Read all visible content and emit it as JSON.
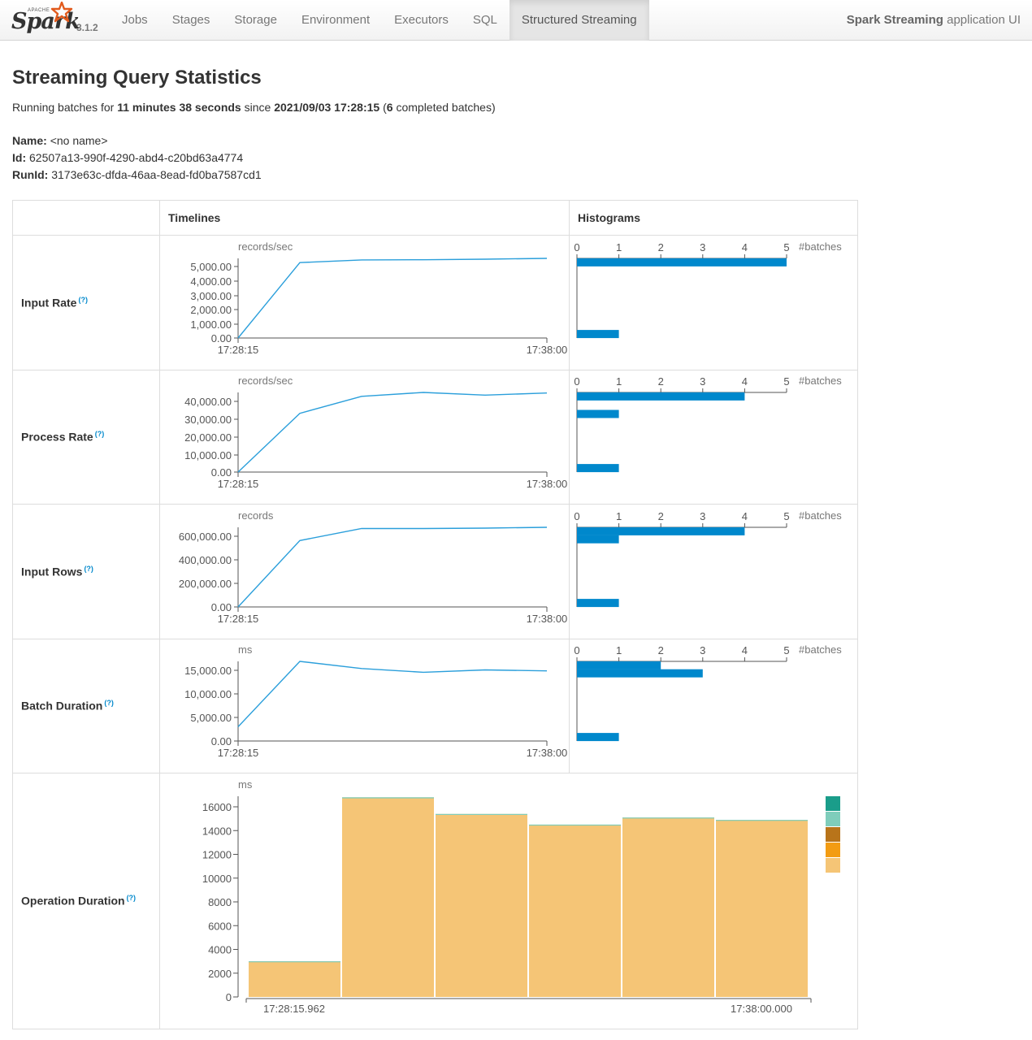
{
  "navbar": {
    "logo_apache": "APACHE",
    "logo_text": "Spark",
    "version": "3.1.2",
    "items": [
      {
        "label": "Jobs",
        "active": false
      },
      {
        "label": "Stages",
        "active": false
      },
      {
        "label": "Storage",
        "active": false
      },
      {
        "label": "Environment",
        "active": false
      },
      {
        "label": "Executors",
        "active": false
      },
      {
        "label": "SQL",
        "active": false
      },
      {
        "label": "Structured Streaming",
        "active": true
      }
    ],
    "app_name": "Spark Streaming",
    "app_suffix": "application UI"
  },
  "page": {
    "title": "Streaming Query Statistics",
    "summary": {
      "prefix": "Running batches for",
      "duration": "11 minutes 38 seconds",
      "since_word": "since",
      "since_time": "2021/09/03 17:28:15",
      "open_paren": "(",
      "completed": "6",
      "completed_suffix": "completed batches)"
    },
    "info": {
      "name_label": "Name:",
      "name_value": "<no name>",
      "id_label": "Id:",
      "id_value": "62507a13-990f-4290-abd4-c20bd63a4774",
      "runid_label": "RunId:",
      "runid_value": "3173e63c-dfda-46aa-8ead-fd0ba7587cd1"
    }
  },
  "table": {
    "headers": {
      "timelines": "Timelines",
      "histograms": "Histograms"
    },
    "help_marker": "(?)",
    "rows": [
      {
        "label": "Input Rate"
      },
      {
        "label": "Process Rate"
      },
      {
        "label": "Input Rows"
      },
      {
        "label": "Batch Duration"
      },
      {
        "label": "Operation Duration"
      }
    ]
  },
  "colors": {
    "line": "#2b9fdb",
    "histogram_bar": "#0088cc",
    "op_duration": [
      "#1a9d8a",
      "#7fcdbb",
      "#b8741a",
      "#f39c12",
      "#f5c576"
    ]
  },
  "chart_data": [
    {
      "type": "line",
      "title": "Input Rate",
      "ylabel": "records/sec",
      "x": [
        "17:28:15",
        "",
        "",
        "",
        "",
        "17:38:00"
      ],
      "values": [
        0,
        5500,
        5700,
        5710,
        5750,
        5810
      ],
      "yticks": [
        "5,000.00",
        "4,000.00",
        "3,000.00",
        "2,000.00",
        "1,000.00",
        "0.00"
      ],
      "ylim": [
        0,
        5810
      ],
      "xticks": [
        "17:28:15",
        "17:38:00"
      ],
      "grid": false
    },
    {
      "type": "bar",
      "title": "Input Rate histogram",
      "xlabel": "#batches",
      "xticks": [
        "0",
        "1",
        "2",
        "3",
        "4",
        "5"
      ],
      "counts": [
        5,
        1
      ],
      "bin_fractions": [
        0.95,
        0.05
      ],
      "xlim": [
        0,
        5
      ]
    },
    {
      "type": "line",
      "title": "Process Rate",
      "ylabel": "records/sec",
      "x": [
        "17:28:15",
        "",
        "",
        "",
        "",
        "17:38:00"
      ],
      "values": [
        0,
        33000,
        42500,
        44700,
        43200,
        44400
      ],
      "yticks": [
        "40,000.00",
        "30,000.00",
        "20,000.00",
        "10,000.00",
        "0.00"
      ],
      "ylim": [
        0,
        44700
      ],
      "xticks": [
        "17:28:15",
        "17:38:00"
      ],
      "grid": false
    },
    {
      "type": "bar",
      "title": "Process Rate histogram",
      "xlabel": "#batches",
      "xticks": [
        "0",
        "1",
        "2",
        "3",
        "4",
        "5"
      ],
      "counts": [
        4,
        1,
        1
      ],
      "bin_fractions": [
        0.95,
        0.73,
        0.05
      ],
      "xlim": [
        0,
        5
      ]
    },
    {
      "type": "line",
      "title": "Input Rows",
      "ylabel": "records",
      "x": [
        "17:28:15",
        "",
        "",
        "",
        "",
        "17:38:00"
      ],
      "values": [
        0,
        560000,
        662000,
        662000,
        665000,
        672000
      ],
      "yticks": [
        "600,000.00",
        "400,000.00",
        "200,000.00",
        "0.00"
      ],
      "ylim": [
        0,
        672000
      ],
      "xticks": [
        "17:28:15",
        "17:38:00"
      ],
      "grid": false
    },
    {
      "type": "bar",
      "title": "Input Rows histogram",
      "xlabel": "#batches",
      "xticks": [
        "0",
        "1",
        "2",
        "3",
        "4",
        "5"
      ],
      "counts": [
        4,
        1,
        1
      ],
      "bin_fractions": [
        0.95,
        0.85,
        0.05
      ],
      "xlim": [
        0,
        5
      ]
    },
    {
      "type": "line",
      "title": "Batch Duration",
      "ylabel": "ms",
      "x": [
        "17:28:15",
        "",
        "",
        "",
        "",
        "17:38:00"
      ],
      "values": [
        3000,
        16800,
        15300,
        14500,
        15000,
        14800
      ],
      "yticks": [
        "15,000.00",
        "10,000.00",
        "5,000.00",
        "0.00"
      ],
      "ylim": [
        0,
        16800
      ],
      "xticks": [
        "17:28:15",
        "17:38:00"
      ],
      "grid": false
    },
    {
      "type": "bar",
      "title": "Batch Duration histogram",
      "xlabel": "#batches",
      "xticks": [
        "0",
        "1",
        "2",
        "3",
        "4",
        "5"
      ],
      "counts": [
        2,
        3,
        1
      ],
      "bin_fractions": [
        0.95,
        0.85,
        0.05
      ],
      "xlim": [
        0,
        5
      ]
    },
    {
      "type": "bar",
      "stacked": true,
      "title": "Operation Duration",
      "ylabel": "ms",
      "xticks": [
        "17:28:15.962",
        "17:38:00.000"
      ],
      "yticks": [
        "16000",
        "14000",
        "12000",
        "10000",
        "8000",
        "6000",
        "4000",
        "2000",
        "0"
      ],
      "ylim": [
        0,
        16800
      ],
      "totals": [
        3000,
        16800,
        15400,
        14500,
        15100,
        14900
      ],
      "top_segment": [
        30,
        90,
        80,
        70,
        80,
        70
      ]
    }
  ]
}
